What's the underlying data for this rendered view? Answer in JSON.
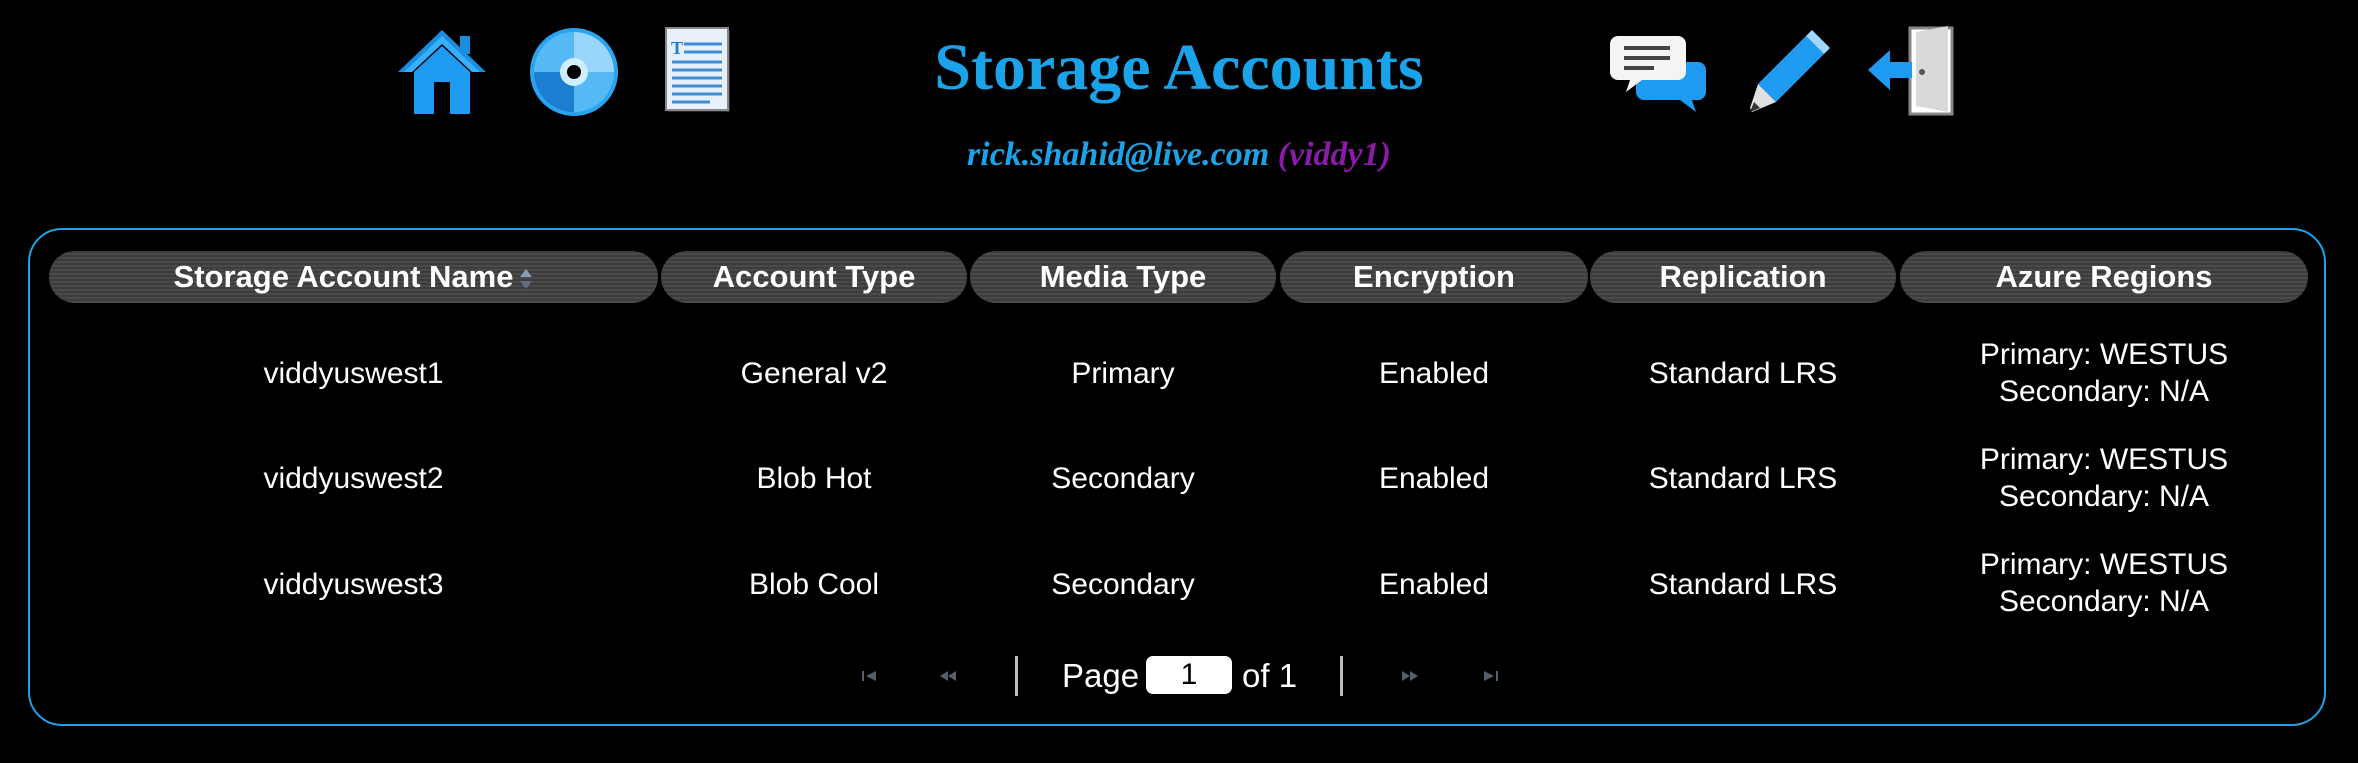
{
  "header": {
    "title": "Storage Accounts",
    "user_email": "rick.shahid@live.com",
    "user_alias": "(viddy1)",
    "nav_icons": [
      "home-icon",
      "disc-icon",
      "document-icon",
      "chat-icon",
      "pencil-icon",
      "logout-icon"
    ]
  },
  "table": {
    "columns": [
      "Storage Account Name",
      "Account Type",
      "Media Type",
      "Encryption",
      "Replication",
      "Azure Regions"
    ],
    "rows": [
      {
        "name": "viddyuswest1",
        "account_type": "General v2",
        "media_type": "Primary",
        "encryption": "Enabled",
        "replication": "Standard LRS",
        "region_primary": "Primary: WESTUS",
        "region_secondary": "Secondary: N/A"
      },
      {
        "name": "viddyuswest2",
        "account_type": "Blob Hot",
        "media_type": "Secondary",
        "encryption": "Enabled",
        "replication": "Standard LRS",
        "region_primary": "Primary: WESTUS",
        "region_secondary": "Secondary: N/A"
      },
      {
        "name": "viddyuswest3",
        "account_type": "Blob Cool",
        "media_type": "Secondary",
        "encryption": "Enabled",
        "replication": "Standard LRS",
        "region_primary": "Primary: WESTUS",
        "region_secondary": "Secondary: N/A"
      }
    ]
  },
  "pager": {
    "page_label": "Page",
    "current_page": "1",
    "of_label": "of 1"
  },
  "colors": {
    "accent": "#1aa3e8",
    "alias": "#8a1aa8",
    "background": "#000000"
  }
}
